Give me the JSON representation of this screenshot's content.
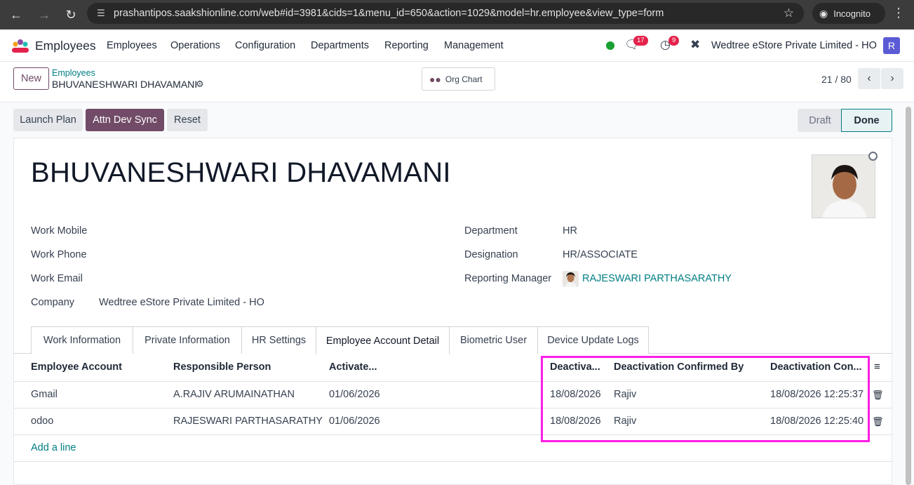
{
  "browser": {
    "url": "prashantipos.saakshionline.com/web#id=3981&cids=1&menu_id=650&action=1029&model=hr.employee&view_type=form",
    "incognito_label": "Incognito"
  },
  "navbar": {
    "app_name": "Employees",
    "menu": [
      "Employees",
      "Operations",
      "Configuration",
      "Departments",
      "Reporting",
      "Management"
    ],
    "messages_count": "17",
    "activities_count": "9",
    "company": "Wedtree eStore Private Limited - HO",
    "user_initial": "R"
  },
  "control_panel": {
    "new_label": "New",
    "breadcrumb_parent": "Employees",
    "breadcrumb_current": "BHUVANESHWARI DHAVAMANI",
    "org_chart_label": "Org Chart",
    "pager": "21 / 80"
  },
  "actions": {
    "launch_plan": "Launch Plan",
    "attn_dev_sync": "Attn Dev Sync",
    "reset": "Reset"
  },
  "status": {
    "draft": "Draft",
    "done": "Done"
  },
  "employee": {
    "name": "BHUVANESHWARI DHAVAMANI",
    "labels": {
      "work_mobile": "Work Mobile",
      "work_phone": "Work Phone",
      "work_email": "Work Email",
      "company": "Company",
      "department": "Department",
      "designation": "Designation",
      "reporting_manager": "Reporting Manager"
    },
    "company": "Wedtree eStore Private Limited - HO",
    "department": "HR",
    "designation": "HR/ASSOCIATE",
    "reporting_manager": "RAJESWARI PARTHASARATHY"
  },
  "tabs": [
    "Work Information",
    "Private Information",
    "HR Settings",
    "Employee Account Detail",
    "Biometric User",
    "Device Update Logs"
  ],
  "table": {
    "headers": [
      "Employee Account",
      "Responsible Person",
      "Activate...",
      "Deactiva...",
      "Deactivation Confirmed By",
      "Deactivation Con..."
    ],
    "rows": [
      [
        "Gmail",
        "A.RAJIV ARUMAINATHAN",
        "01/06/2026",
        "18/08/2026",
        "Rajiv",
        "18/08/2026 12:25:37"
      ],
      [
        "odoo",
        "RAJESWARI PARTHASARATHY",
        "01/06/2026",
        "18/08/2026",
        "Rajiv",
        "18/08/2026 12:25:40"
      ]
    ],
    "add_line": "Add a line"
  },
  "colors": {
    "primary": "#714b67",
    "link": "#017e84",
    "highlight": "#ff1ee6"
  }
}
